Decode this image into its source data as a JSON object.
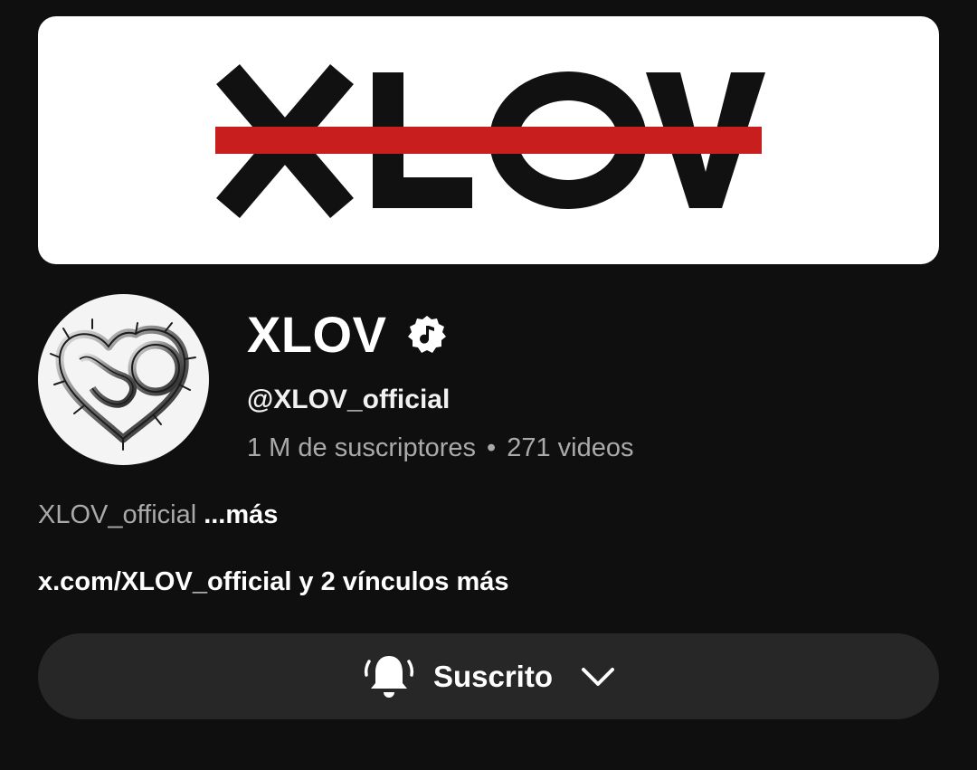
{
  "banner": {
    "logo_text": "XLOV",
    "strike_color": "#c81e1e"
  },
  "channel": {
    "name": "XLOV",
    "verified_icon": "music-note-verified-icon",
    "handle": "@XLOV_official",
    "subscribers": "1 M de suscriptores",
    "separator": "•",
    "videos": "271 videos"
  },
  "description": {
    "text": "XLOV_official",
    "more_label": "...más"
  },
  "links": {
    "primary": "x.com/XLOV_official",
    "more": "y 2 vínculos más"
  },
  "subscribe": {
    "icon": "bell-icon",
    "label": "Suscrito",
    "dropdown_icon": "chevron-down-icon"
  },
  "colors": {
    "background": "#0f0f0f",
    "button_bg": "#272727",
    "secondary_text": "#aaaaaa"
  }
}
